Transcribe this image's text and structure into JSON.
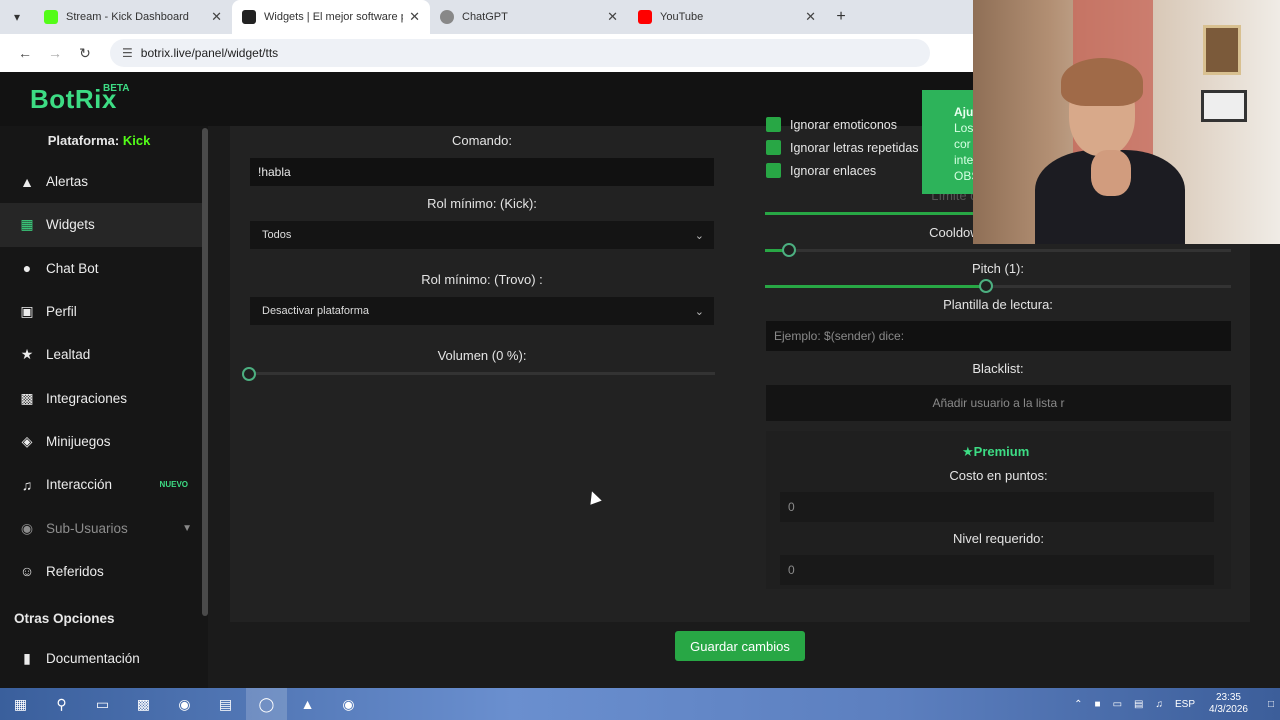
{
  "browser": {
    "tabs": [
      {
        "title": "Stream - Kick Dashboard",
        "favicon_color": "#53fc18"
      },
      {
        "title": "Widgets | El mejor software par",
        "favicon_color": "#222222"
      },
      {
        "title": "ChatGPT",
        "favicon_color": "#888888"
      },
      {
        "title": "YouTube",
        "favicon_color": "#ff0000"
      }
    ],
    "url": "botrix.live/panel/widget/tts"
  },
  "app": {
    "logo": "BotRix",
    "beta": "BETA"
  },
  "sidebar": {
    "platform_label": "Plataforma:",
    "platform_value": "Kick",
    "items": [
      {
        "label": "Alertas",
        "icon": "alert-icon"
      },
      {
        "label": "Widgets",
        "icon": "widgets-icon"
      },
      {
        "label": "Chat Bot",
        "icon": "chat-icon"
      },
      {
        "label": "Perfil",
        "icon": "profile-icon"
      },
      {
        "label": "Lealtad",
        "icon": "trophy-icon"
      },
      {
        "label": "Integraciones",
        "icon": "integrations-icon"
      },
      {
        "label": "Minijuegos",
        "icon": "gamepad-icon"
      },
      {
        "label": "Interacción",
        "icon": "music-icon",
        "badge": "NUEVO"
      },
      {
        "label": "Sub-Usuarios",
        "icon": "users-icon"
      },
      {
        "label": "Referidos",
        "icon": "referrals-icon"
      }
    ],
    "other_title": "Otras Opciones",
    "other_items": [
      {
        "label": "Documentación",
        "icon": "docs-icon"
      }
    ]
  },
  "left_panel": {
    "command_label": "Comando:",
    "command_value": "!habla",
    "min_role_kick_label": "Rol mínimo: (Kick):",
    "min_role_kick_value": "Todos",
    "min_role_trovo_label": "Rol mínimo: (Trovo) :",
    "min_role_trovo_value": "Desactivar plataforma",
    "volume_label": "Volumen (0 %):",
    "volume_percent": 0
  },
  "right_panel": {
    "checks": [
      "Ignorar emoticonos",
      "Ignorar letras repetidas",
      "Ignorar enlaces"
    ],
    "limit_partial": "Límite de",
    "cooldown_label": "Cooldown",
    "pitch_label": "Pitch (1):",
    "reading_template_label": "Plantilla de lectura:",
    "reading_template_placeholder": "Ejemplo: $(sender) dice:",
    "blacklist_label": "Blacklist:",
    "blacklist_placeholder": "Añadir usuario a la lista r",
    "premium_title": "Premium",
    "cost_label": "Costo en puntos:",
    "cost_value": "0",
    "level_label": "Nivel requerido:",
    "level_value": "0"
  },
  "toast": {
    "title": "Aju",
    "lines": [
      "Los",
      "cor",
      "inte",
      "OBS"
    ]
  },
  "save_button": "Guardar cambios",
  "taskbar": {
    "lang": "ESP",
    "time": "23:35",
    "date": "4/3/2026"
  },
  "colors": {
    "accent": "#3ddc84",
    "button": "#28a745",
    "kick": "#53fc18"
  }
}
